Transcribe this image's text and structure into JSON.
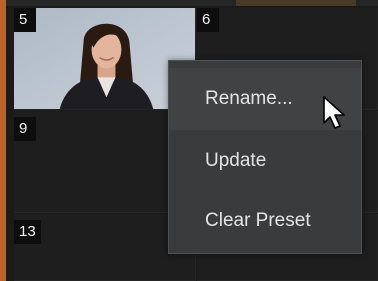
{
  "grid": {
    "cells": [
      {
        "id": "5",
        "label": "5",
        "has_thumbnail": true
      },
      {
        "id": "6",
        "label": "6",
        "has_thumbnail": false
      },
      {
        "id": "9",
        "label": "9",
        "has_thumbnail": false
      },
      {
        "id": "13",
        "label": "13",
        "has_thumbnail": false
      }
    ]
  },
  "context_menu": {
    "items": [
      {
        "label": "Rename...",
        "hovered": true
      },
      {
        "label": "Update"
      },
      {
        "label": "Clear Preset"
      }
    ]
  },
  "colors": {
    "accent": "#b8642a",
    "menu_bg": "#3a3b3c",
    "grid_bg": "#1e1e1e"
  },
  "icons": {
    "cursor": "mouse-pointer-icon"
  }
}
